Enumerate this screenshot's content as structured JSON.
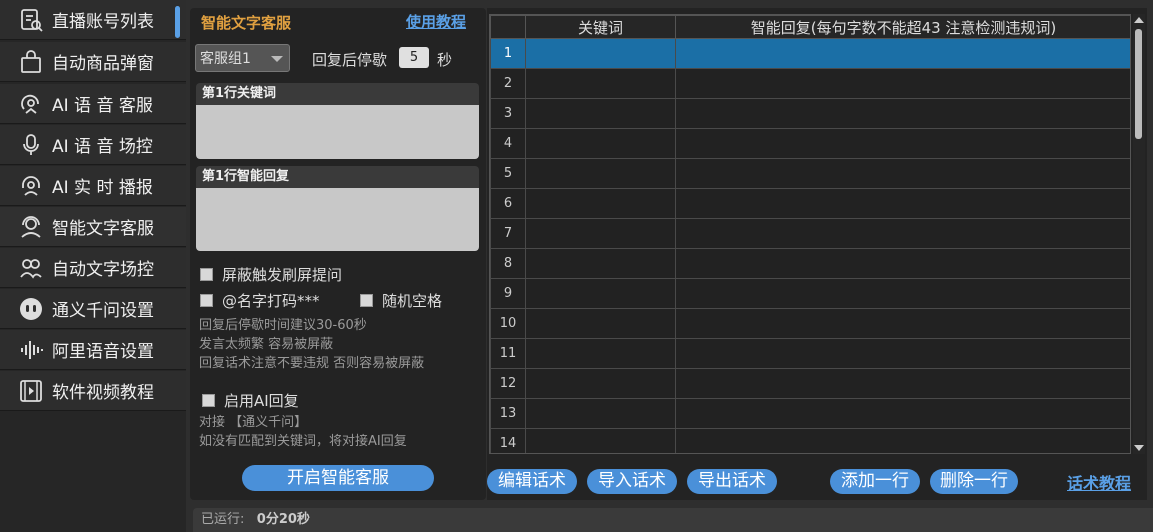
{
  "sidebar": {
    "items": [
      {
        "label": "直播账号列表",
        "icon": "account-list-icon"
      },
      {
        "label": "自动商品弹窗",
        "icon": "shopping-bag-icon"
      },
      {
        "label": "AI 语 音 客服",
        "icon": "voice-service-icon"
      },
      {
        "label": "AI 语 音 场控",
        "icon": "microphone-icon"
      },
      {
        "label": "AI 实 时 播报",
        "icon": "headset-icon"
      },
      {
        "label": "智能文字客服",
        "icon": "agent-icon"
      },
      {
        "label": "自动文字场控",
        "icon": "users-icon"
      },
      {
        "label": "通义千问设置",
        "icon": "robot-face-icon"
      },
      {
        "label": "阿里语音设置",
        "icon": "soundwave-icon"
      },
      {
        "label": "软件视频教程",
        "icon": "video-icon"
      }
    ]
  },
  "panel": {
    "title": "智能文字客服",
    "tutorial_link": "使用教程",
    "group_select": "客服组1",
    "pause_label": "回复后停歇",
    "pause_value": "5",
    "sec_label": "秒",
    "keyword_header": "第1行关键词",
    "reply_header": "第1行智能回复",
    "chk_block": "屏蔽触发刷屏提问",
    "chk_name": "@名字打码***",
    "chk_space": "随机空格",
    "notes": [
      "回复后停歇时间建议30-60秒",
      "发言太频繁 容易被屏蔽",
      "回复话术注意不要违规 否则容易被屏蔽"
    ],
    "chk_ai": "启用AI回复",
    "ai_notes": [
      "对接 【通义千问】",
      "如没有匹配到关键词，将对接AI回复"
    ],
    "start_button": "开启智能客服"
  },
  "table": {
    "columns": [
      "关键词",
      "智能回复(每句字数不能超43 注意检测违规词)"
    ],
    "rows": [
      "1",
      "2",
      "3",
      "4",
      "5",
      "6",
      "7",
      "8",
      "9",
      "10",
      "11",
      "12",
      "13",
      "14"
    ],
    "selected_row": "1"
  },
  "toolbar": {
    "edit": "编辑话术",
    "import": "导入话术",
    "export": "导出话术",
    "add_row": "添加一行",
    "delete_row": "删除一行",
    "tutorial": "话术教程"
  },
  "status": {
    "label": "已运行:",
    "value": "0分20秒"
  },
  "colors": {
    "accent": "#4a90d9",
    "title": "#e0a040",
    "selected_row": "#1b6fa6"
  }
}
